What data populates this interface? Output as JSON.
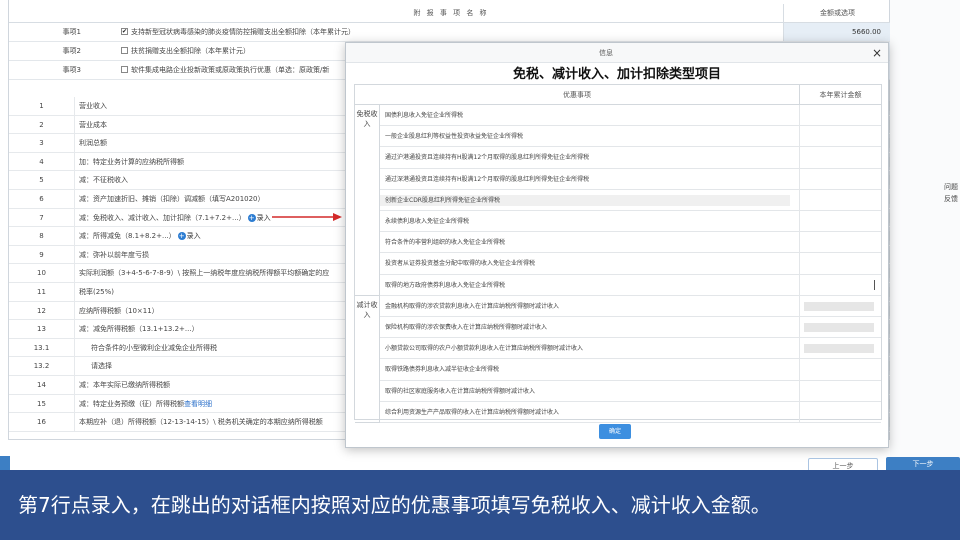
{
  "form": {
    "header": {
      "name_col": "附 报 事 项 名 称",
      "amount_col": "金额或选项"
    },
    "events": [
      {
        "label": "事项1",
        "checked": true,
        "text": "支持新型冠状病毒感染的肺炎疫情防控捐赠支出全额扣除（本年累计元）",
        "amount": "5660.00"
      },
      {
        "label": "事项2",
        "checked": false,
        "text": "扶贫捐赠支出全额扣除（本年累计元）",
        "amount": ""
      },
      {
        "label": "事项3",
        "checked": false,
        "text": "软件集成电路企业投新政策或原政策执行优惠（单选：原政策/新",
        "amount": ""
      }
    ],
    "lines": [
      {
        "no": "1",
        "text": "营业收入"
      },
      {
        "no": "2",
        "text": "营业成本"
      },
      {
        "no": "3",
        "text": "利润总额"
      },
      {
        "no": "4",
        "text": "加：特定业务计算的应纳税所得额"
      },
      {
        "no": "5",
        "text": "减：不征税收入"
      },
      {
        "no": "6",
        "text": "减：资产加速折旧、摊销（扣除）调减额（填写A201020）"
      },
      {
        "no": "7",
        "text": "减：免税收入、减计收入、加计扣除（7.1+7.2+...）",
        "record": "录入"
      },
      {
        "no": "8",
        "text": "减：所得减免（8.1+8.2+...）",
        "record": "录入"
      },
      {
        "no": "9",
        "text": "减：弥补以前年度亏损"
      },
      {
        "no": "10",
        "text": "实际利润额（3+4-5-6-7-8-9）\\ 按照上一纳税年度应纳税所得额平均额确定的应"
      },
      {
        "no": "11",
        "text": "税率(25%)"
      },
      {
        "no": "12",
        "text": "应纳所得税额（10×11）"
      },
      {
        "no": "13",
        "text": "减：减免所得税额（13.1+13.2+...）"
      },
      {
        "no": "13.1",
        "text": "符合条件的小型微利企业减免企业所得税",
        "indent": true
      },
      {
        "no": "13.2",
        "text": "请选择",
        "indent": true
      },
      {
        "no": "14",
        "text": "减：本年实际已缴纳所得税额"
      },
      {
        "no": "15",
        "text": "减：特定业务预缴（征）所得税额",
        "link": "查看明细"
      },
      {
        "no": "16",
        "text": "本期应补（退）所得税额（12-13-14-15）\\ 税务机关确定的本期应纳所得税额"
      }
    ]
  },
  "side_notes": [
    "问题",
    "反馈"
  ],
  "dialog": {
    "title": "信息",
    "close": "×",
    "heading": "免税、减计收入、加计扣除类型项目",
    "col_item": "优惠事项",
    "col_amount": "本年累计金额",
    "groups": [
      {
        "label": "免税收入",
        "rows": [
          {
            "text": "国债利息收入免征企业所得税"
          },
          {
            "text": "一般企业股息红利等权益性投资收益免征企业所得税"
          },
          {
            "text": "通过沪港通投资且连续持有H股满12个月取得的股息红利所得免征企业所得税"
          },
          {
            "text": "通过深港通投资且连续持有H股满12个月取得的股息红利所得免征企业所得税"
          },
          {
            "text": "创新企业CDR股息红利所得免征企业所得税",
            "highlight": true
          },
          {
            "text": "永续债利息收入免征企业所得税"
          },
          {
            "text": "符合条件的非营利组织的收入免征企业所得税"
          },
          {
            "text": "投资者从证券投资基金分配中取得的收入免征企业所得税"
          },
          {
            "text": "取得的地方政府债券利息收入免征企业所得税",
            "cursor": true
          }
        ]
      },
      {
        "label": "减计收入",
        "rows": [
          {
            "text": "金融机构取得的涉农贷款利息收入在计算应纳税所得额时减计收入",
            "filled": true
          },
          {
            "text": "保险机构取得的涉农保费收入在计算应纳税所得额时减计收入",
            "filled": true
          },
          {
            "text": "小额贷款公司取得的农户小额贷款利息收入在计算应纳税所得额时减计收入",
            "filled": true
          },
          {
            "text": "取得铁路债券利息收入减半征收企业所得税"
          },
          {
            "text": "取得的社区家庭服务收入在计算应纳税所得额时减计收入"
          },
          {
            "text": "综合利用资源生产产品取得的收入在计算应纳税所得额时减计收入"
          }
        ]
      }
    ],
    "ok": "确定"
  },
  "nav": {
    "prev": "上一步",
    "next": "下一步"
  },
  "caption": "第7行点录入，在跳出的对话框内按照对应的优惠事项填写免税收入、减计收入金额。",
  "colors": {
    "caption_bg": "#2d4f8e",
    "primary": "#3d7fc4",
    "arrow": "#d42a2a",
    "ok": "#3d8fe0"
  }
}
